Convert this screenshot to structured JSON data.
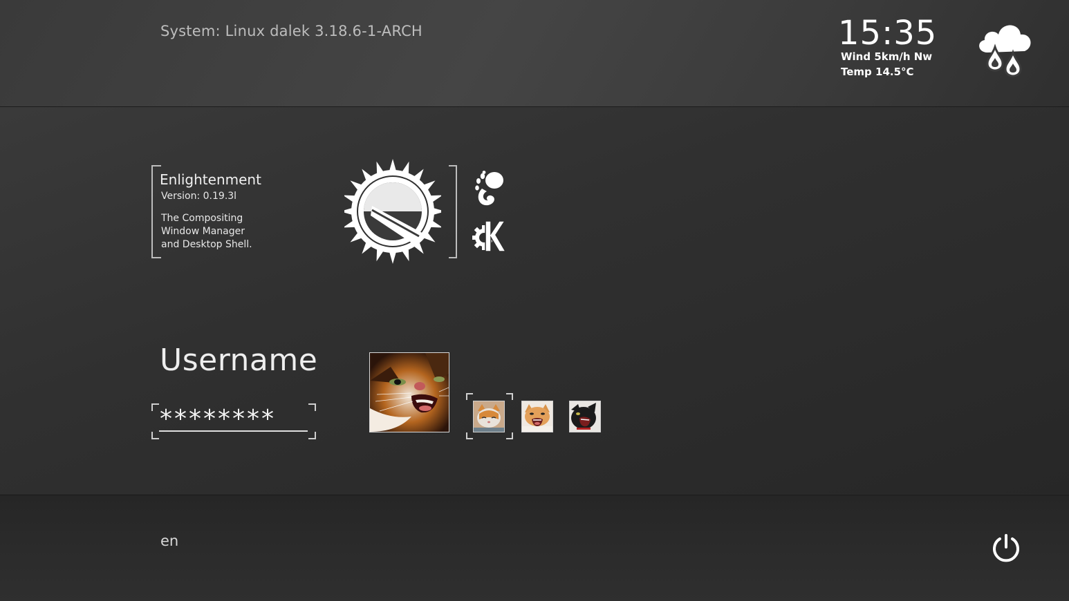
{
  "top_bar": {
    "system_info": "System: Linux dalek 3.18.6-1-ARCH",
    "clock": "15:35",
    "weather": {
      "wind": "Wind 5km/h Nw",
      "temp": "Temp 14.5°C",
      "icon": "cloud-rain-icon"
    }
  },
  "session": {
    "name": "Enlightenment",
    "version": "Version: 0.19.3l",
    "description": "The Compositing\nWindow Manager\nand Desktop Shell.",
    "alternatives": [
      {
        "name": "GNOME",
        "icon": "gnome-icon"
      },
      {
        "name": "KDE",
        "icon": "kde-icon"
      }
    ]
  },
  "login": {
    "username_label": "Username",
    "password_masked": "********",
    "avatars": [
      {
        "icon": "cat-avatar-main",
        "selected": false
      },
      {
        "icon": "cat-avatar-1",
        "selected": true
      },
      {
        "icon": "cat-avatar-2",
        "selected": false
      },
      {
        "icon": "cat-avatar-3",
        "selected": false
      }
    ]
  },
  "bottom_bar": {
    "language": "en",
    "power_icon": "power-icon"
  },
  "colors": {
    "background": "#2d2d2d",
    "text": "#e6e6e6",
    "accent": "#ffffff"
  }
}
